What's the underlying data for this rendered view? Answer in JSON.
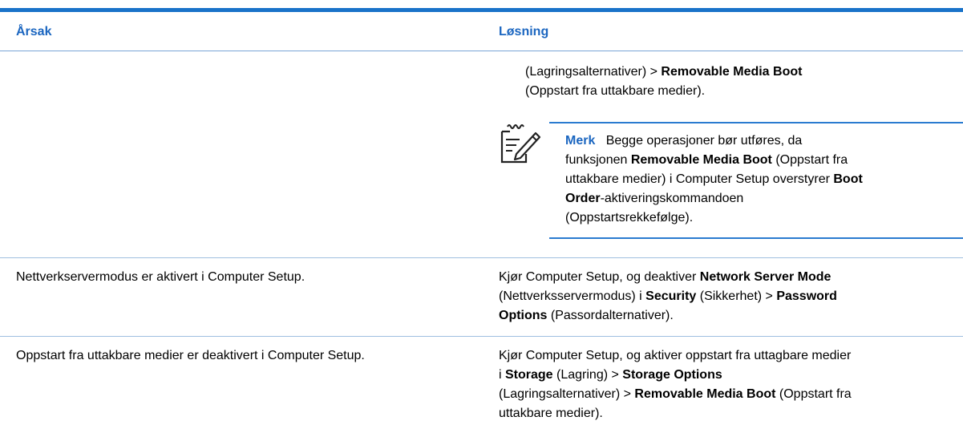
{
  "table": {
    "headers": {
      "cause": "Årsak",
      "solution": "Løsning"
    },
    "row0": {
      "solution_line1_a": "(Lagringsalternativer) > ",
      "solution_line1_b": "Removable Media Boot",
      "solution_line2": "(Oppstart fra uttakbare medier).",
      "note": {
        "label": "Merk",
        "l1": "Begge operasjoner bør utføres, da",
        "l2a": "funksjonen ",
        "l2b": "Removable Media Boot",
        "l2c": " (Oppstart fra",
        "l3a": "uttakbare medier) i Computer Setup overstyrer ",
        "l3b": "Boot",
        "l4a": "Order",
        "l4b": "-aktiveringskommandoen",
        "l5": "(Oppstartsrekkefølge)."
      }
    },
    "row1": {
      "cause": "Nettverkservermodus er aktivert i Computer Setup.",
      "s1a": "Kjør Computer Setup, og deaktiver ",
      "s1b": "Network Server Mode",
      "s2a": "(Nettverksservermodus) i ",
      "s2b": "Security",
      "s2c": " (Sikkerhet) > ",
      "s2d": "Password",
      "s3a": "Options",
      "s3b": " (Passordalternativer)."
    },
    "row2": {
      "cause": "Oppstart fra uttakbare medier er deaktivert i Computer Setup.",
      "s1": "Kjør Computer Setup, og aktiver oppstart fra uttagbare medier",
      "s2a": "i ",
      "s2b": "Storage",
      "s2c": " (Lagring) > ",
      "s2d": "Storage Options",
      "s3a": "(Lagringsalternativer) > ",
      "s3b": "Removable Media Boot",
      "s3c": " (Oppstart fra",
      "s4": "uttakbare medier)."
    }
  },
  "colors": {
    "accent": "#1b66c0",
    "rule": "#1a73c9"
  },
  "icons": {
    "note": "note-pencil-icon"
  }
}
